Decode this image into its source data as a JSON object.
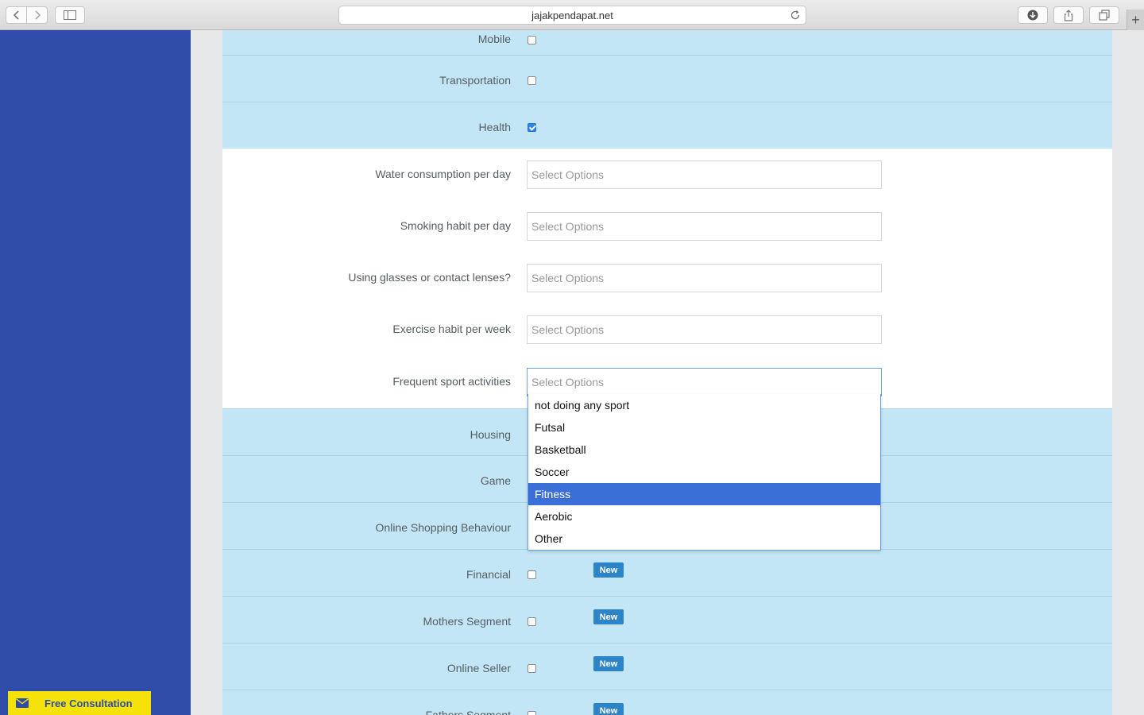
{
  "browser": {
    "url": "jajakpendapat.net"
  },
  "rows_top": [
    {
      "label": "Mobile",
      "checked": false
    },
    {
      "label": "Transportation",
      "checked": false
    },
    {
      "label": "Health",
      "checked": true
    }
  ],
  "health_fields": [
    {
      "label": "Water consumption per day",
      "placeholder": "Select Options"
    },
    {
      "label": "Smoking habit per day",
      "placeholder": "Select Options"
    },
    {
      "label": "Using glasses or contact lenses?",
      "placeholder": "Select Options"
    },
    {
      "label": "Exercise habit per week",
      "placeholder": "Select Options"
    },
    {
      "label": "Frequent sport activities",
      "placeholder": "Select Options"
    }
  ],
  "dropdown": {
    "options": [
      "not doing any sport",
      "Futsal",
      "Basketball",
      "Soccer",
      "Fitness",
      "Aerobic",
      "Other"
    ],
    "highlighted": "Fitness"
  },
  "rows_bottom": [
    {
      "label": "Housing",
      "checked": false,
      "badge": ""
    },
    {
      "label": "Game",
      "checked": false,
      "badge": ""
    },
    {
      "label": "Online Shopping Behaviour",
      "checked": false,
      "badge": ""
    },
    {
      "label": "Financial",
      "checked": false,
      "badge": "New"
    },
    {
      "label": "Mothers Segment",
      "checked": false,
      "badge": "New"
    },
    {
      "label": "Online Seller",
      "checked": false,
      "badge": "New"
    },
    {
      "label": "Fathers Segment",
      "checked": false,
      "badge": "New"
    }
  ],
  "consultation": {
    "label": "Free Consultation"
  },
  "colors": {
    "sidebar": "#2f4ca9",
    "row_bg": "#c3e6f6",
    "highlight": "#3a6fd8",
    "badge": "#2e84c8",
    "consult_bg": "#f5e20a"
  }
}
